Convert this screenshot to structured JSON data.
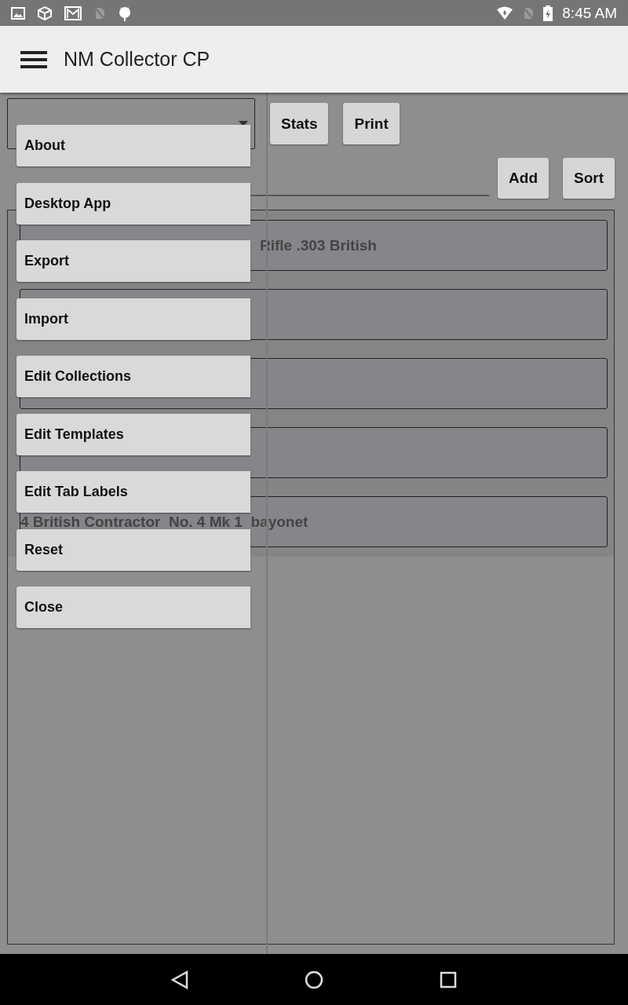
{
  "status_bar": {
    "time": "8:45 AM"
  },
  "app_bar": {
    "title": "NM Collector CP"
  },
  "top_buttons": [
    "Stats",
    "Print"
  ],
  "list_buttons": [
    "Add",
    "Sort"
  ],
  "list_rows": [
    {
      "text": "Rifle .303 British",
      "covered": true
    },
    {},
    {},
    {},
    {
      "text": "4 British Contractor  No. 4 Mk 1  bayonet",
      "covered": false
    }
  ],
  "menu": {
    "items": [
      "About",
      "Desktop App",
      "Export",
      "Import",
      "Edit Collections",
      "Edit Templates",
      "Edit Tab Labels",
      "Reset",
      "Close"
    ]
  }
}
